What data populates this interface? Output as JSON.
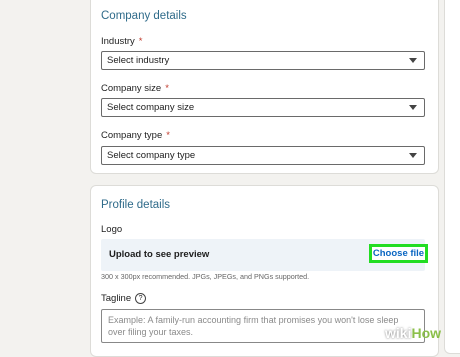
{
  "company_details": {
    "title": "Company details",
    "industry_label": "Industry",
    "industry_value": "Select industry",
    "size_label": "Company size",
    "size_value": "Select company size",
    "type_label": "Company type",
    "type_value": "Select company type",
    "required_mark": "*"
  },
  "profile_details": {
    "title": "Profile details",
    "logo_label": "Logo",
    "upload_text": "Upload to see preview",
    "choose_file_label": "Choose file",
    "hint": "300 x 300px recommended. JPGs, JPEGs, and PNGs supported.",
    "tagline_label": "Tagline",
    "help_icon_glyph": "?",
    "tagline_placeholder": "Example: A family-run accounting firm that promises you won't lose sleep over filing your taxes."
  },
  "colors": {
    "section_title": "#2f6b8a",
    "highlight": "#22dd22",
    "link": "#0a66c2",
    "upload_bg": "#eef3f8"
  },
  "icons": {
    "dropdown": "chevron-down-icon",
    "help": "help-icon"
  },
  "watermark": {
    "wiki": "wiki",
    "how": "How"
  }
}
